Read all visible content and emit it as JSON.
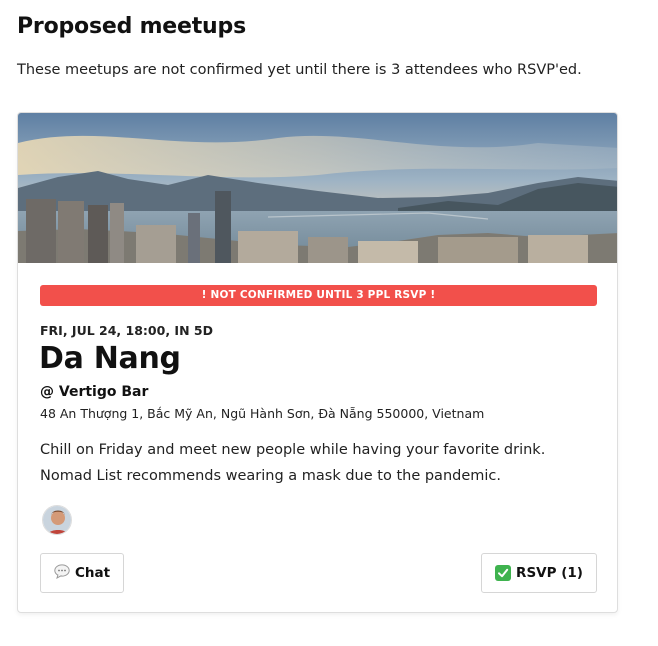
{
  "page": {
    "heading": "Proposed meetups",
    "intro": "These meetups are not confirmed yet until there is 3 attendees who RSVP'ed."
  },
  "meetup": {
    "alert": "! NOT CONFIRMED UNTIL 3 PPL RSVP !",
    "date": "FRI, JUL 24, 18:00, IN 5D",
    "city": "Da Nang",
    "venue": "@ Vertigo Bar",
    "address": "48 An Thượng 1, Bắc Mỹ An, Ngũ Hành Sơn, Đà Nẵng 550000, Vietnam",
    "description": "Chill on Friday and meet new people while having your favorite drink. Nomad List recommends wearing a mask due to the pandemic.",
    "hero_icon": "city-skyline-photo",
    "alert_color": "#f2504b"
  },
  "actions": {
    "chat_label": "Chat",
    "chat_icon": "speech-bubble-icon",
    "rsvp_label": "RSVP (1)",
    "rsvp_icon": "check-mark-icon"
  }
}
